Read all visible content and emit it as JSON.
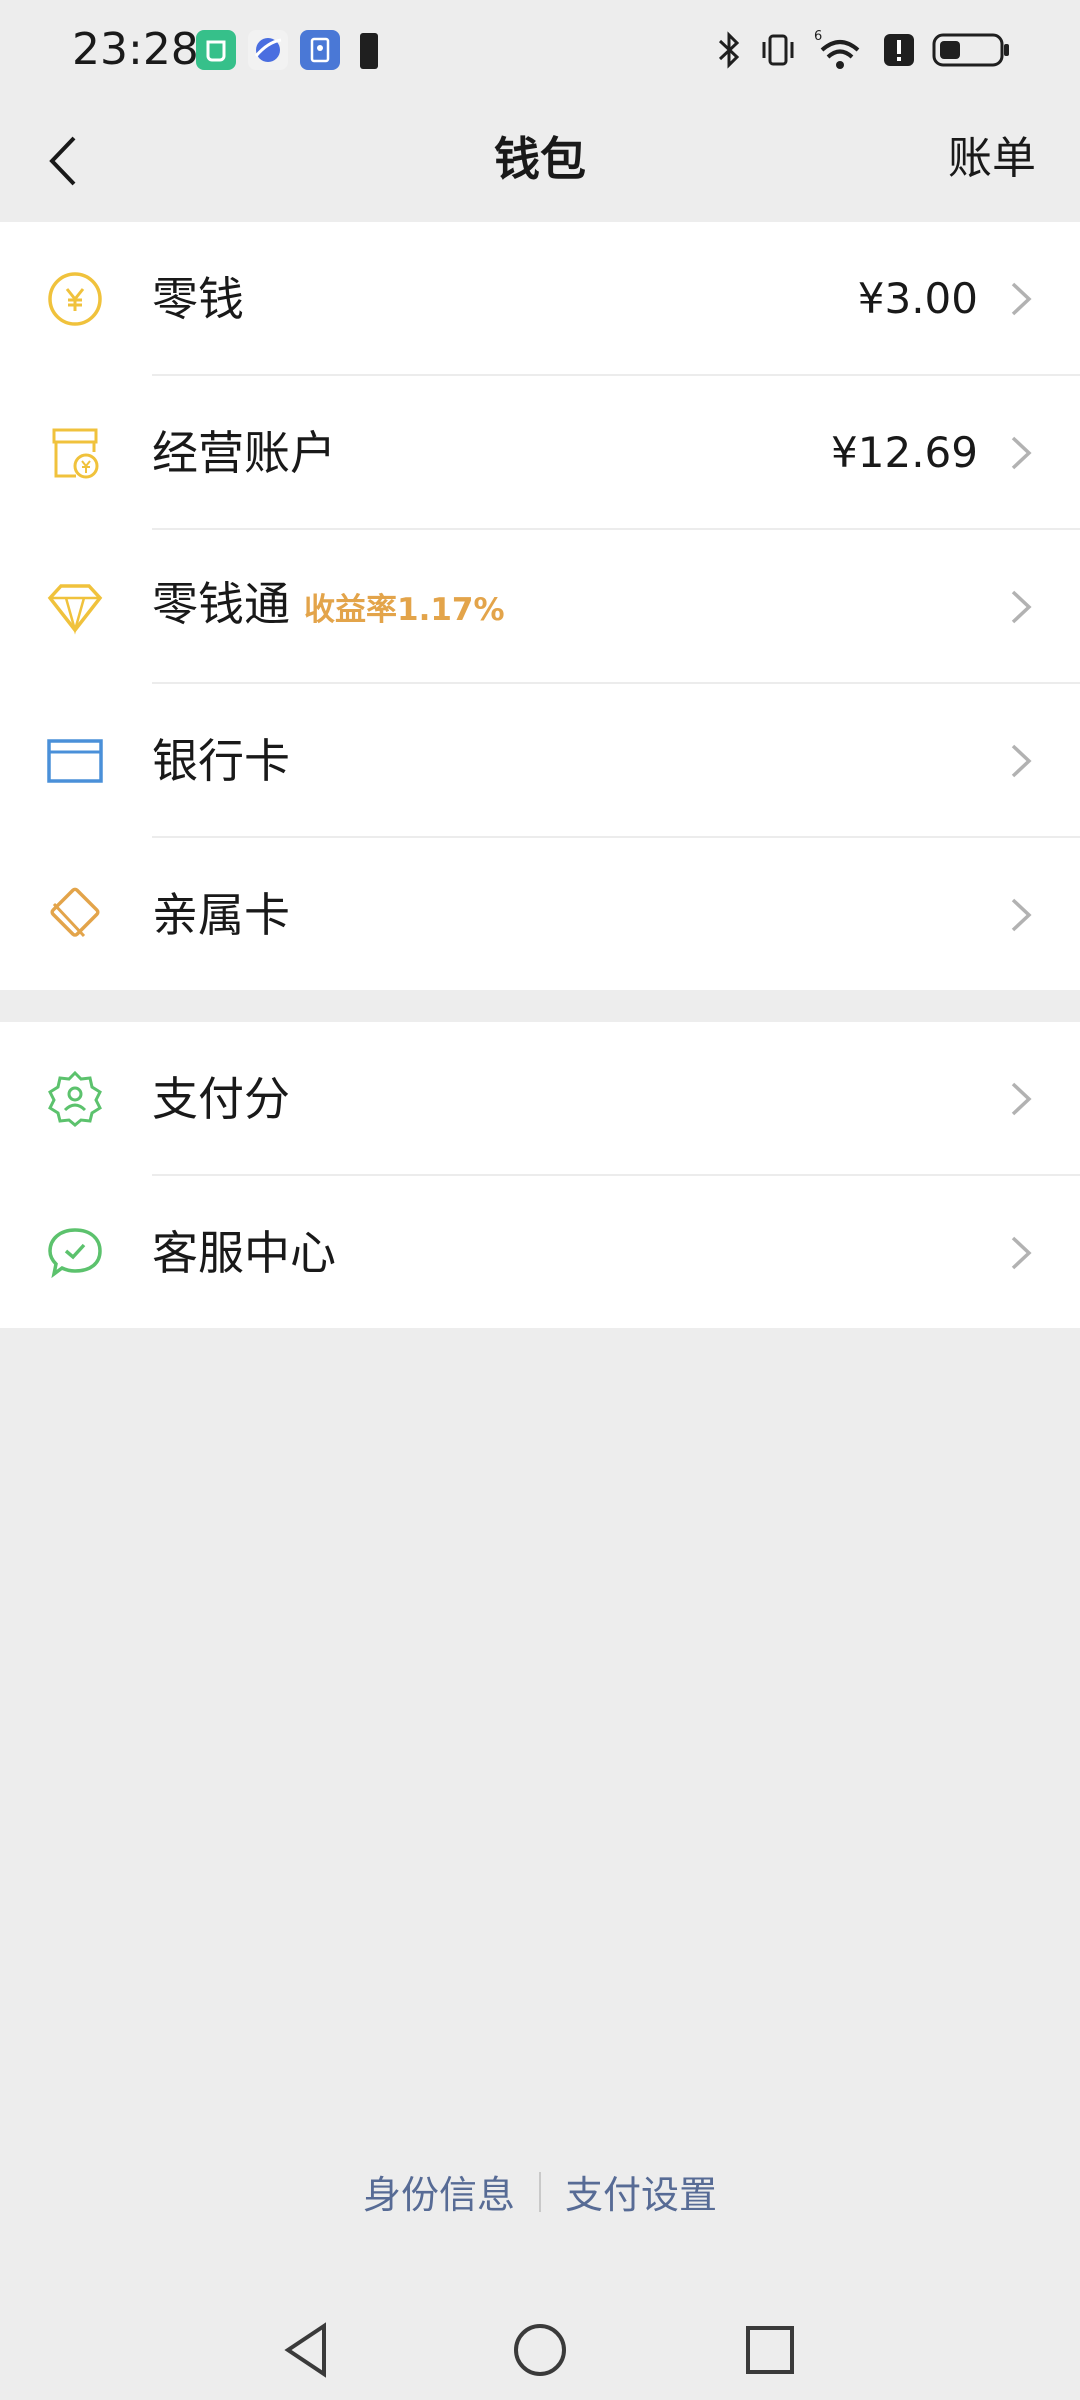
{
  "status_bar": {
    "time": "23:28",
    "icons": [
      "mi-home-icon",
      "browser-icon",
      "book-icon",
      "battery-alert-icon",
      "bluetooth-icon",
      "vibrate-icon",
      "wifi-icon",
      "alert-icon",
      "battery-icon"
    ],
    "network_label": "6"
  },
  "nav": {
    "title": "钱包",
    "right_label": "账单"
  },
  "wallet_items": [
    {
      "label": "零钱",
      "value": "¥3.00",
      "icon": "yuan-coin-icon"
    },
    {
      "label": "经营账户",
      "value": "¥12.69",
      "icon": "store-icon"
    },
    {
      "label": "零钱通",
      "badge": "收益率1.17%",
      "icon": "diamond-icon"
    },
    {
      "label": "银行卡",
      "icon": "bank-card-icon"
    },
    {
      "label": "亲属卡",
      "icon": "family-card-icon"
    }
  ],
  "service_items": [
    {
      "label": "支付分",
      "icon": "pay-score-icon"
    },
    {
      "label": "客服中心",
      "icon": "customer-service-icon"
    }
  ],
  "footer": {
    "identity_label": "身份信息",
    "settings_label": "支付设置"
  },
  "colors": {
    "background": "#ededed",
    "card": "#ffffff",
    "yellow": "#f0c23c",
    "orange": "#e3a44a",
    "blue": "#4a90d9",
    "green": "#5cc26d",
    "link": "#576b95"
  }
}
